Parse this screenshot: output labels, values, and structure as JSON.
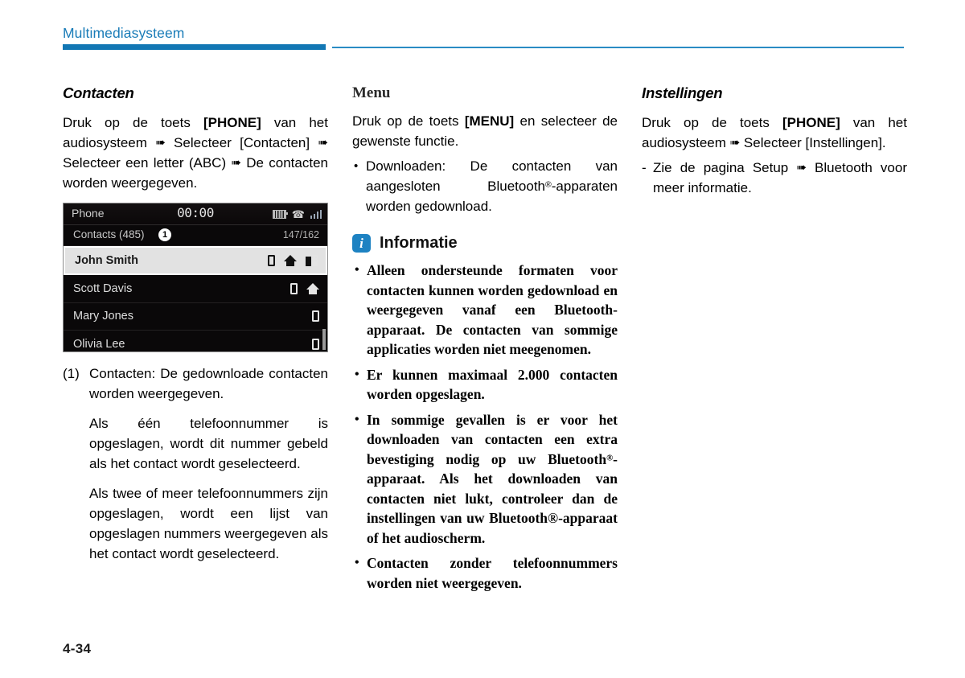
{
  "header": {
    "title": "Multimediasysteem",
    "accent_color": "#1277b4"
  },
  "footer": {
    "page_number": "4-34"
  },
  "columns": {
    "left": {
      "heading": "Contacten",
      "intro_parts": {
        "p1": "Druk op de toets ",
        "b1": "[PHONE]",
        "p2": " van het audiosysteem ",
        "arrow1": "➠",
        "p3": " Selecteer [Contacten] ",
        "arrow2": "➠",
        "p4": " Selecteer een letter (ABC) ",
        "arrow3": "➠",
        "p5": " De contacten worden weergegeven."
      },
      "caption": {
        "number": "(1)",
        "text": "Contacten: De gedownloade contacten worden weergegeven.",
        "para2": "Als één telefoonnummer is opgeslagen, wordt dit nummer gebeld als het contact wordt geselecteerd.",
        "para3": "Als twee of meer telefoonnummers zijn opgeslagen, wordt een lijst van opgeslagen nummers weergegeven als het contact wordt geselecteerd."
      }
    },
    "middle": {
      "heading": "Menu",
      "intro_parts": {
        "p1": "Druk op de toets ",
        "b1": "[MENU]",
        "p2": " en selecteer de gewenste functie."
      },
      "bullets": [
        {
          "pre": "Downloaden: De contacten van aangesloten Bluetooth",
          "sup": "®",
          "post": "-apparaten worden gedownload."
        }
      ],
      "info": {
        "badge_letter": "i",
        "badge_color": "#1d82c2",
        "title": "Informatie",
        "bullets": [
          {
            "pre": "Alleen ondersteunde formaten voor contacten kunnen worden gedownload en weergegeven vanaf een Bluetooth-apparaat. De contacten van sommige applicaties worden niet meegenomen.",
            "sup": "",
            "post": ""
          },
          {
            "pre": "Er kunnen maximaal 2.000 contacten worden opgeslagen.",
            "sup": "",
            "post": ""
          },
          {
            "pre": "In sommige gevallen is er voor het downloaden van contacten een extra bevestiging nodig op uw Bluetooth",
            "sup": "®",
            "post": "-apparaat. Als het downloaden van contacten niet lukt, controleer dan de instellingen van uw Bluetooth®-apparaat of het audioscherm."
          },
          {
            "pre": "Contacten zonder telefoonnummers worden niet weergegeven.",
            "sup": "",
            "post": ""
          }
        ]
      }
    },
    "right": {
      "heading": "Instellingen",
      "intro_parts": {
        "p1": "Druk op de toets ",
        "b1": "[PHONE]",
        "p2": " van het audiosysteem ",
        "arrow1": "➠",
        "p3": " Selecteer [Instellingen]."
      },
      "dash_items": [
        {
          "pre": "Zie de pagina Setup ",
          "arrow": "➠",
          "post": " Bluetooth voor meer informatie."
        }
      ]
    }
  },
  "device_screenshot": {
    "status_bar": {
      "title": "Phone",
      "clock": "00:00",
      "icons": [
        "battery-icon",
        "bluetooth-phone-icon",
        "signal-icon"
      ]
    },
    "list_header": {
      "title": "Contacts (485)",
      "callout": "1",
      "count": "147/162"
    },
    "rows": [
      {
        "name": "John Smith",
        "selected": true,
        "icons": [
          "mobile-icon",
          "home-icon",
          "office-icon"
        ]
      },
      {
        "name": "Scott Davis",
        "selected": false,
        "icons": [
          "mobile-icon",
          "home-icon"
        ]
      },
      {
        "name": "Mary Jones",
        "selected": false,
        "icons": [
          "mobile-icon"
        ]
      },
      {
        "name": "Olivia Lee",
        "selected": false,
        "icons": [
          "mobile-icon"
        ]
      }
    ]
  }
}
